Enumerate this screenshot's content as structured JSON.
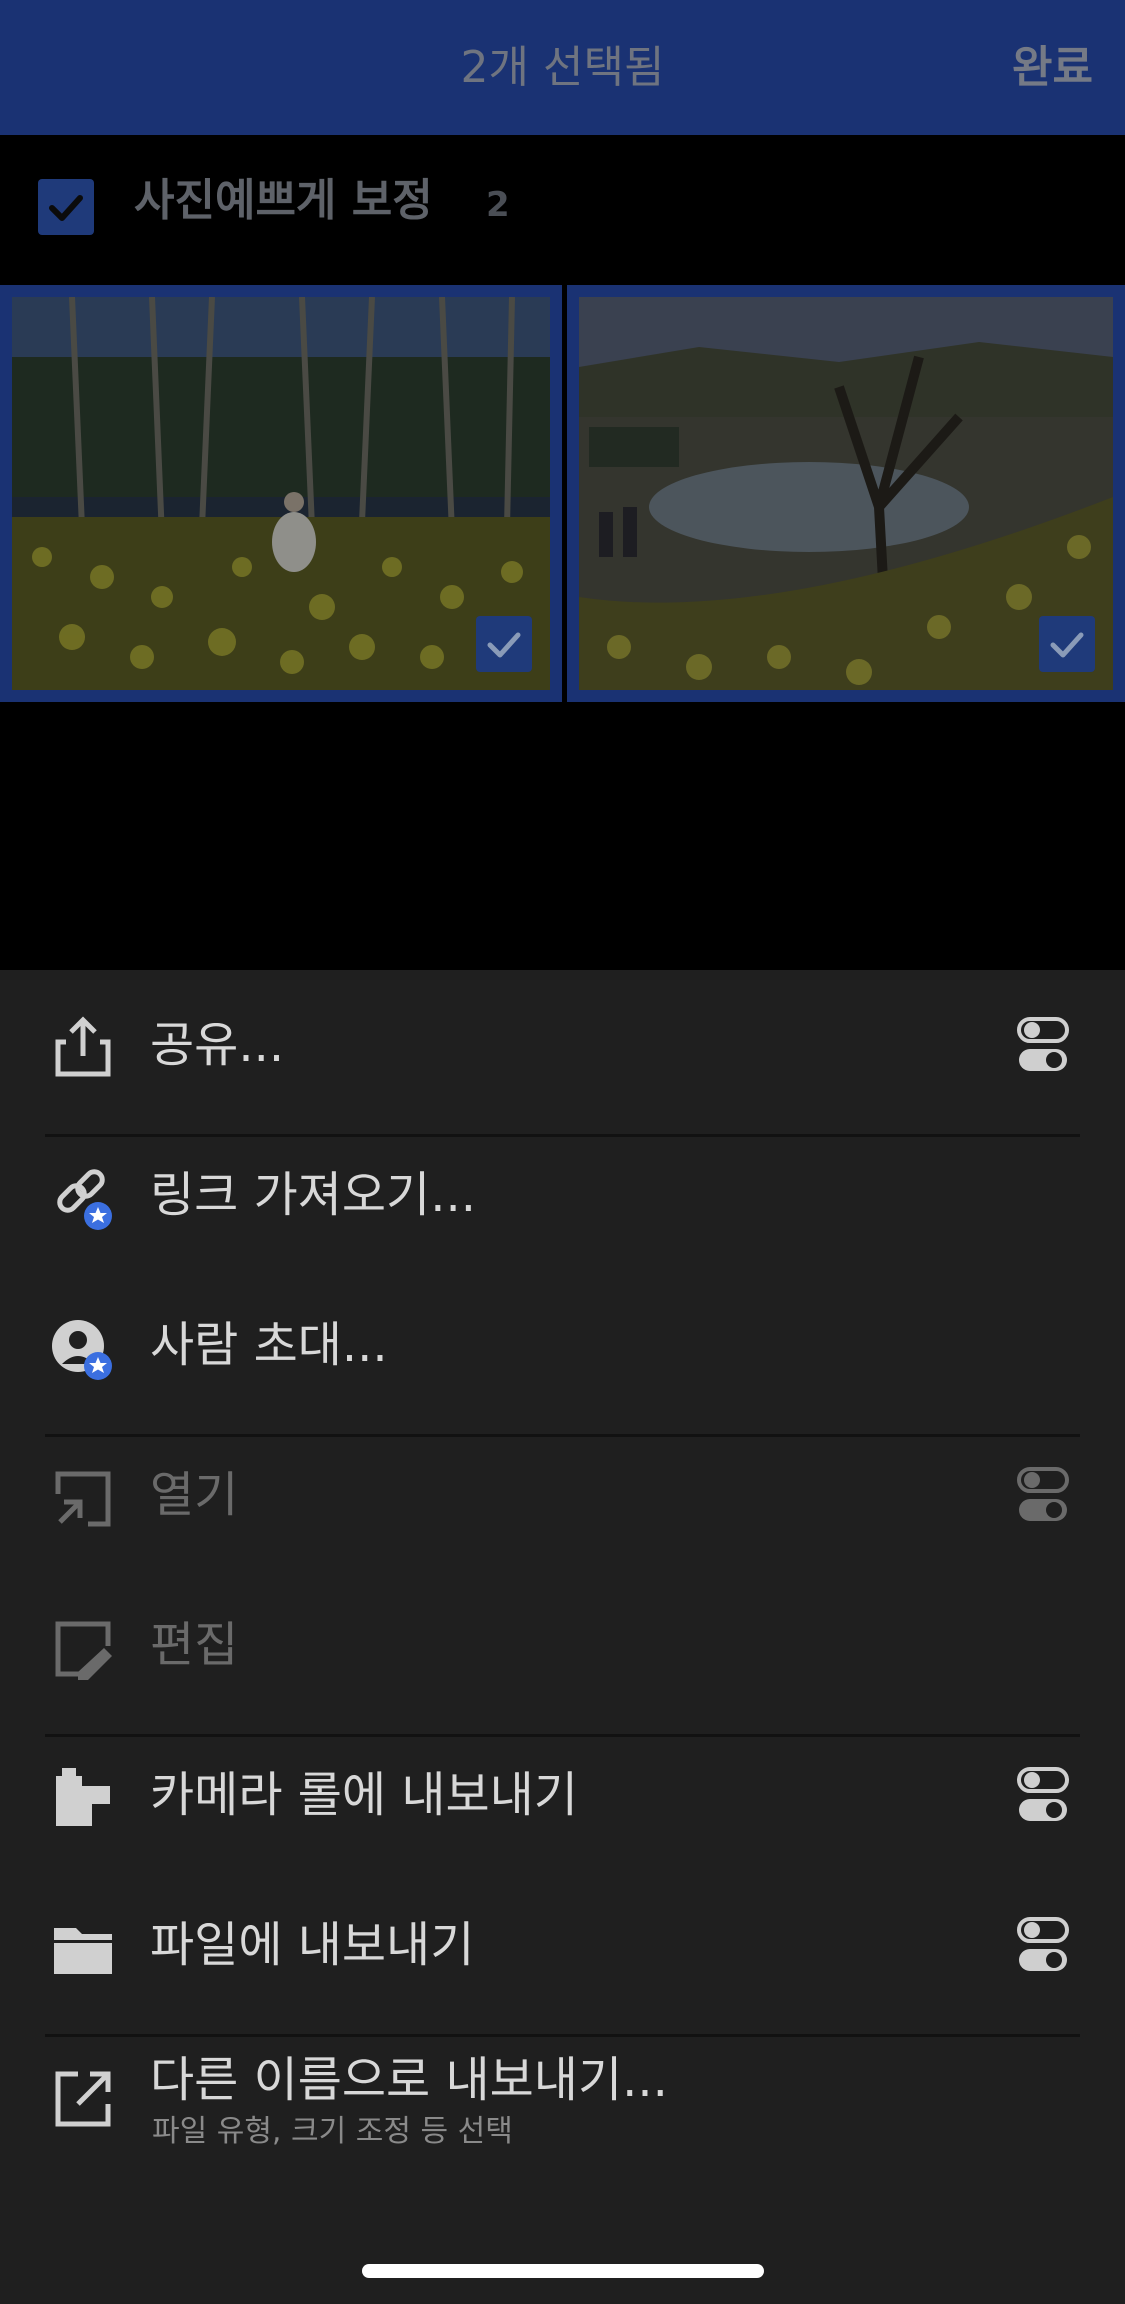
{
  "header": {
    "title": "2개 선택됨",
    "done_label": "완료"
  },
  "album": {
    "name": "사진예쁘게 보정",
    "count": "2"
  },
  "photos": [
    {
      "selected": true
    },
    {
      "selected": true
    }
  ],
  "menu": {
    "share": "공유...",
    "get_link": "링크 가져오기...",
    "invite_people": "사람 초대...",
    "open": "열기",
    "edit": "편집",
    "export_camera_roll": "카메라 롤에 내보내기",
    "export_files": "파일에 내보내기",
    "export_as": "다른 이름으로 내보내기...",
    "export_as_sub": "파일 유형, 크기 조정 등 선택"
  },
  "colors": {
    "header_bg": "#1a3273",
    "sheet_bg": "#1f1f1f",
    "premium_badge": "#3b6fe0"
  },
  "icons": {
    "share": "share-icon",
    "link": "link-icon",
    "invite": "person-icon",
    "open": "open-icon",
    "edit": "edit-icon",
    "camera_roll": "camera-roll-icon",
    "folder": "folder-icon",
    "export": "export-icon",
    "options": "settings-toggle-icon"
  }
}
